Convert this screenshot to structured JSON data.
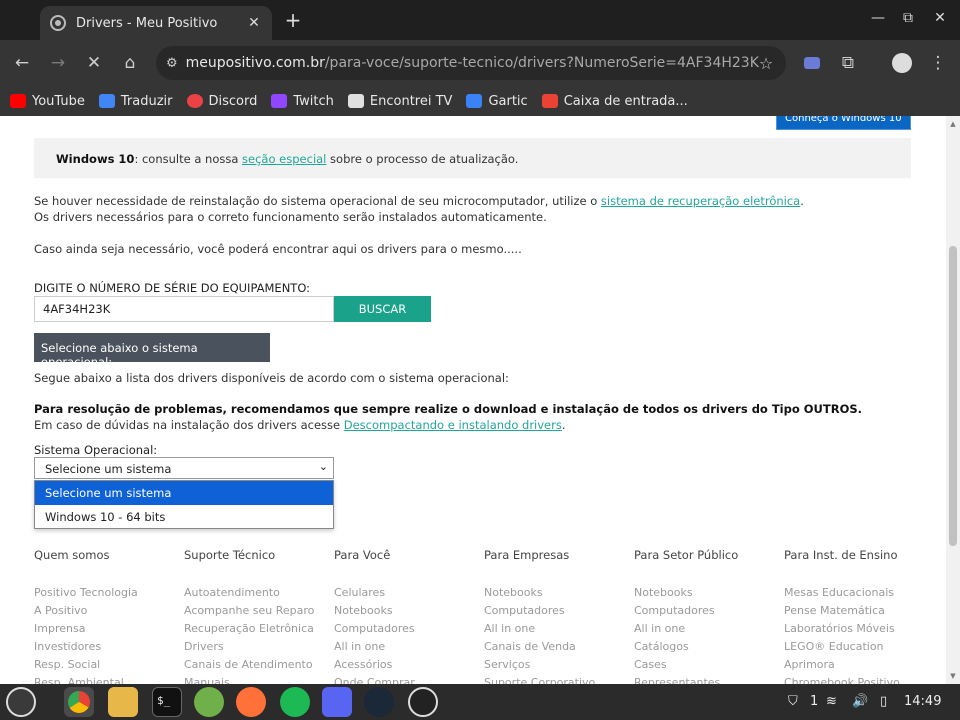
{
  "browser": {
    "tab_title": "Drivers - Meu Positivo",
    "tab_close": "✕",
    "new_tab": "+",
    "window_controls": {
      "minimize": "—",
      "maximize": "⧉",
      "close": "✕"
    },
    "url_host": "meupositivo.com.br",
    "url_path": "/para-voce/suporte-tecnico/drivers?NumeroSerie=4AF34H23K",
    "icons": [
      "back-icon",
      "forward-icon",
      "stop-icon",
      "home-icon",
      "site-settings-icon",
      "star-icon",
      "extension-icon",
      "profile-icon",
      "menu-icon"
    ]
  },
  "bookmarks": [
    {
      "label": "YouTube",
      "color": "#ff0000"
    },
    {
      "label": "Traduzir",
      "color": "#4285f4"
    },
    {
      "label": "Discord",
      "color": "#ed4245"
    },
    {
      "label": "Twitch",
      "color": "#9146ff"
    },
    {
      "label": "Encontrei TV",
      "color": "#e0e0e0"
    },
    {
      "label": "Gartic",
      "color": "#3b82f6"
    },
    {
      "label": "Caixa de entrada...",
      "color": "#ea4335"
    }
  ],
  "page": {
    "ms_banner": "Conheça o  Windows 10",
    "notice_bold": "Windows 10",
    "notice_text1": ": consulte a nossa ",
    "notice_link": "seção especial",
    "notice_text2": " sobre o processo de atualização.",
    "reinstall_text": "Se houver necessidade de reinstalação do sistema operacional de seu microcomputador, utilize o ",
    "reinstall_link": "sistema de recuperação eletrônica",
    "reinstall_end": ".",
    "drivers_auto": "Os drivers necessários para o correto funcionamento serão instalados automaticamente.",
    "still_needed": "Caso ainda seja necessário, você poderá encontrar aqui os drivers para o mesmo.....",
    "serial_label": "DIGITE O NÚMERO DE SÉRIE DO EQUIPAMENTO:",
    "serial_value": "4AF34H23K",
    "search_button": "BUSCAR",
    "select_os_header": "Selecione abaixo o sistema operacional:",
    "list_intro": "Segue abaixo a lista dos drivers disponíveis de acordo com o sistema operacional:",
    "recommend_bold": "Para resolução de problemas, recomendamos que sempre realize o download e instalação de todos os drivers do Tipo OUTROS.",
    "doubts_text": "Em caso de dúvidas na instalação dos drivers acesse ",
    "doubts_link": "Descompactando e instalando drivers",
    "doubts_end": ".",
    "os_label": "Sistema Operacional:",
    "os_selected": "Selecione um sistema",
    "os_options": [
      "Selecione um sistema",
      "Windows 10 - 64 bits"
    ]
  },
  "footer": [
    {
      "title": "Quem somos",
      "items": [
        "Positivo Tecnologia",
        "A Positivo",
        "Imprensa",
        "Investidores",
        "Resp. Social",
        "Resp. Ambiental"
      ]
    },
    {
      "title": "Suporte Técnico",
      "items": [
        "Autoatendimento",
        "Acompanhe seu Reparo",
        "Recuperação Eletrônica",
        "Drivers",
        "Canais de Atendimento",
        "Manuais"
      ]
    },
    {
      "title": "Para Você",
      "items": [
        "Celulares",
        "Notebooks",
        "Computadores",
        "All in one",
        "Acessórios",
        "Onde Comprar"
      ]
    },
    {
      "title": "Para Empresas",
      "items": [
        "Notebooks",
        "Computadores",
        "All in one",
        "Canais de Venda",
        "Serviços",
        "Suporte Corporativo"
      ]
    },
    {
      "title": "Para Setor Público",
      "items": [
        "Notebooks",
        "Computadores",
        "All in one",
        "Catálogos",
        "Cases",
        "Representantes"
      ]
    },
    {
      "title": "Para Inst. de Ensino",
      "items": [
        "Mesas Educacionais",
        "Pense Matemática",
        "Laboratórios Móveis",
        "LEGO® Education",
        "Aprimora",
        "Chromebook Positivo"
      ]
    }
  ],
  "taskbar": {
    "apps": [
      "mint-menu-icon",
      "chrome-icon",
      "files-icon",
      "terminal-icon",
      "calculator-icon",
      "firefox-icon",
      "spotify-icon",
      "discord-icon",
      "steam-icon",
      "obs-icon"
    ],
    "notification_count": "1",
    "clock": "14:49"
  }
}
